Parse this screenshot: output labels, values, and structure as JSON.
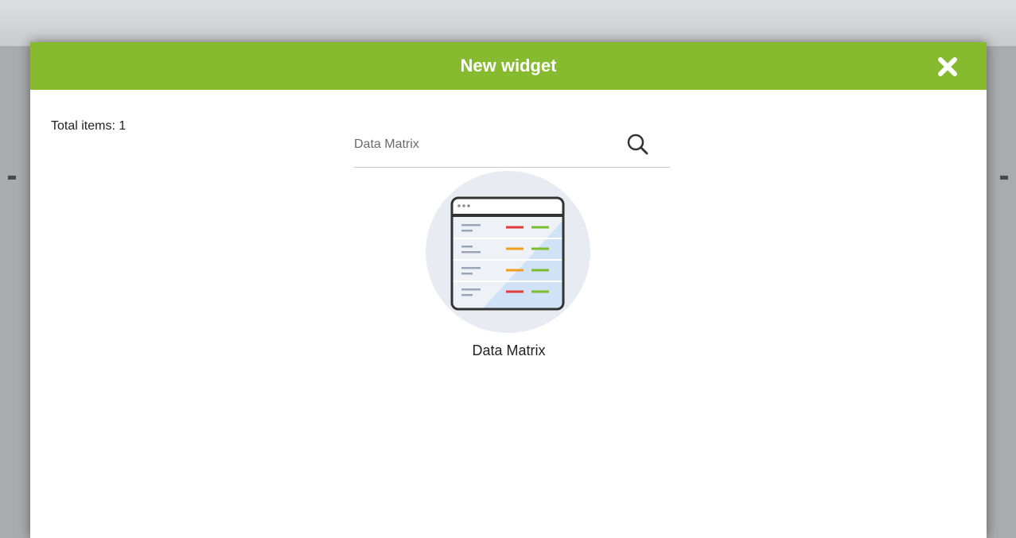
{
  "modal": {
    "title": "New widget"
  },
  "results": {
    "total_label": "Total items: 1"
  },
  "search": {
    "value": "",
    "placeholder": "Data Matrix"
  },
  "widgets": [
    {
      "label": "Data Matrix",
      "icon": "data-matrix-icon"
    }
  ],
  "colors": {
    "header": "#86ba2f",
    "header_text": "#ffffff",
    "icon_bg": "#e8ecf2",
    "status_red": "#e03c3c",
    "status_orange": "#f0a020",
    "status_green": "#7cbf2e"
  }
}
